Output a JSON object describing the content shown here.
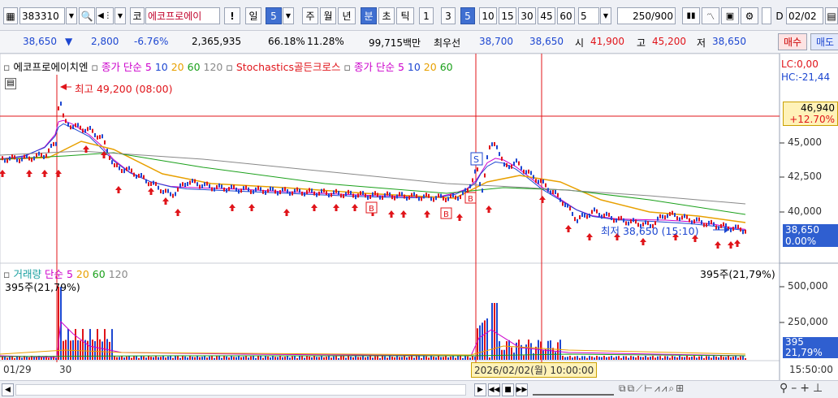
{
  "toolbar": {
    "code": "383310",
    "market_label": "코",
    "stock_name": "에코프로에이",
    "alert_label": "!",
    "period_day": "일",
    "period_value": "5",
    "week": "주",
    "month": "월",
    "year": "년",
    "minute": "분",
    "second": "초",
    "tick": "틱",
    "intervals": [
      "1",
      "3",
      "5",
      "10",
      "15",
      "30",
      "45",
      "60"
    ],
    "interval_input": "5",
    "count_display": "250/900",
    "date_value": "02/02"
  },
  "quote": {
    "price": "38,650",
    "arrow": "▼",
    "change": "2,800",
    "change_pct": "-6.76%",
    "volume": "2,365,935",
    "ratio1": "66.18%",
    "ratio2": "11.28%",
    "amount": "99,715백만",
    "best_ask_label": "최우선",
    "best_ask": "38,700",
    "best_bid": "38,650",
    "open_label": "시",
    "open": "41,900",
    "high_label": "고",
    "high": "45,200",
    "low_label": "저",
    "low": "38,650",
    "buy_button": "매수",
    "sell_button": "매도"
  },
  "legend": {
    "stock": "에코프로에이치엔",
    "price_ma_label": "종가 단순",
    "ma": [
      "5",
      "10",
      "20",
      "60",
      "120"
    ],
    "indicator": "Stochastics골든크로스",
    "price_ma_label2": "종가 단순",
    "ma2": [
      "5",
      "10",
      "20",
      "60"
    ],
    "lc": "LC:0,00",
    "hc": "HC:-21,44",
    "high_annotation": "최고 49,200 (08:00)",
    "low_annotation": "최저 38,650 (15:10)"
  },
  "price_axis": {
    "ticks": [
      "45,000",
      "42,500",
      "40,000"
    ],
    "ref_price": "46,940",
    "ref_change": "+12.70%",
    "cur_price": "38,650",
    "cur_change": "0.00%"
  },
  "volume_panel": {
    "title": "거래량",
    "ma_label": "단순",
    "ma": [
      "5",
      "20",
      "60",
      "120"
    ],
    "value_left": "395주(21,79%)",
    "value_right": "395주(21,79%)",
    "ticks": [
      "500,000",
      "250,000"
    ],
    "cur_value": "395",
    "cur_pct": "21,79%"
  },
  "time_axis": {
    "start": "01/29",
    "day": "30",
    "cursor": "2026/02/02(월) 10:00:00",
    "end": "15:50:00"
  },
  "colors": {
    "up": "#e0141a",
    "down": "#1d47d1",
    "ma5": "#cc00cc",
    "ma10": "#1d47d1",
    "ma20": "#e8a000",
    "ma60": "#1aa01a",
    "ma120": "#888888"
  }
}
